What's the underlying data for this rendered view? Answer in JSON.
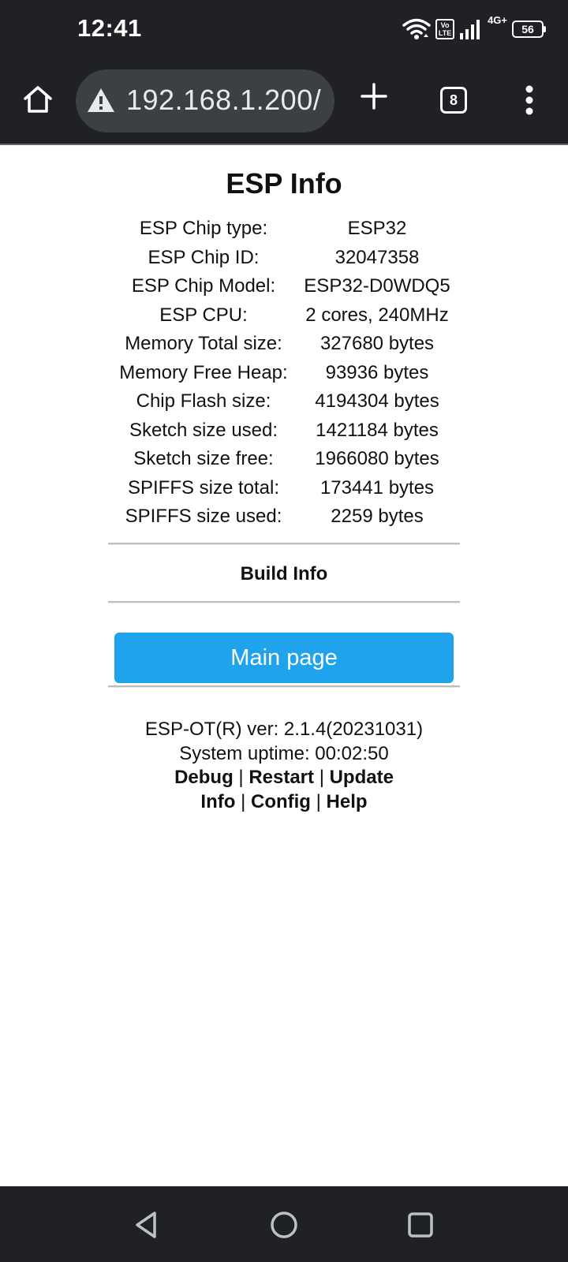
{
  "status_bar": {
    "time": "12:41",
    "volte_label": "Vo LTE",
    "network_type": "4G+",
    "battery": "56",
    "icons": [
      "wifi-icon",
      "volte-icon",
      "signal-icon",
      "battery-icon"
    ]
  },
  "browser": {
    "url": "192.168.1.200/",
    "tab_count": "8",
    "icons": [
      "home-icon",
      "warning-icon",
      "plus-icon",
      "tabs-icon",
      "menu-icon"
    ]
  },
  "page": {
    "title": "ESP Info",
    "rows": [
      {
        "label": "ESP Chip type:",
        "value": "ESP32"
      },
      {
        "label": "ESP Chip ID:",
        "value": "32047358"
      },
      {
        "label": "ESP Chip Model:",
        "value": "ESP32-D0WDQ5"
      },
      {
        "label": "ESP CPU:",
        "value": "2 cores, 240MHz"
      },
      {
        "label": "Memory Total size:",
        "value": "327680 bytes"
      },
      {
        "label": "Memory Free Heap:",
        "value": "93936 bytes"
      },
      {
        "label": "Chip Flash size:",
        "value": "4194304 bytes"
      },
      {
        "label": "Sketch size used:",
        "value": "1421184 bytes"
      },
      {
        "label": "Sketch size free:",
        "value": "1966080 bytes"
      },
      {
        "label": "SPIFFS size total:",
        "value": "173441 bytes"
      },
      {
        "label": "SPIFFS size used:",
        "value": "2259 bytes"
      }
    ],
    "build_info": "Build Info",
    "main_button": "Main page",
    "footer": {
      "version": "ESP-OT(R) ver: 2.1.4(20231031)",
      "uptime": "System uptime: 00:02:50",
      "separator": "|",
      "links_line1": [
        "Debug",
        "Restart",
        "Update"
      ],
      "links_line2": [
        "Info",
        "Config",
        "Help"
      ]
    }
  },
  "nav_bar": {
    "icons": [
      "back-icon",
      "home-circle-icon",
      "recents-icon"
    ]
  },
  "colors": {
    "chrome_dark": "#202124",
    "omnibox": "#3c4043",
    "button_blue": "#1fa3ec"
  }
}
